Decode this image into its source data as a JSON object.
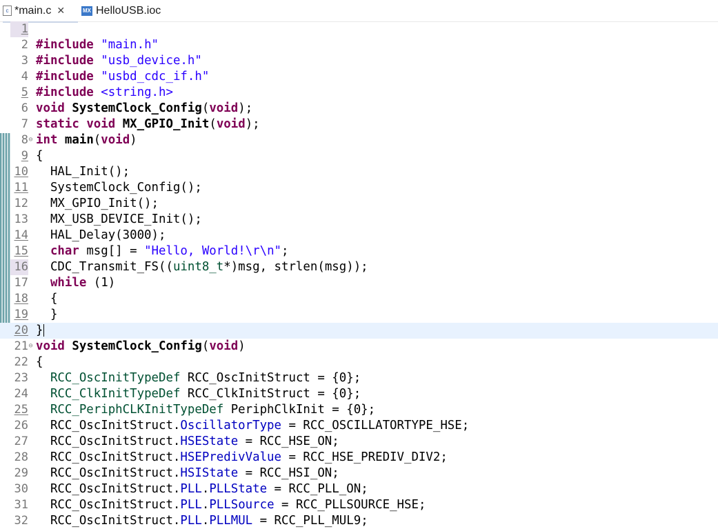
{
  "tabs": [
    {
      "label": "*main.c",
      "icon": "c-file-icon",
      "active": true
    },
    {
      "label": "HelloUSB.ioc",
      "icon": "mx-file-icon",
      "active": false
    }
  ],
  "lines": [
    {
      "n": "1",
      "u": true,
      "hl": true,
      "tokens": []
    },
    {
      "n": "2",
      "tokens": [
        {
          "c": "kw",
          "t": "#include"
        },
        {
          "t": " "
        },
        {
          "c": "str",
          "t": "\"main.h\""
        }
      ]
    },
    {
      "n": "3",
      "tokens": [
        {
          "c": "kw",
          "t": "#include"
        },
        {
          "t": " "
        },
        {
          "c": "str",
          "t": "\"usb_device.h\""
        }
      ]
    },
    {
      "n": "4",
      "tokens": [
        {
          "c": "kw",
          "t": "#include"
        },
        {
          "t": " "
        },
        {
          "c": "str",
          "t": "\"usbd_cdc_if.h\""
        }
      ]
    },
    {
      "n": "5",
      "u": true,
      "tokens": [
        {
          "c": "kw",
          "t": "#include"
        },
        {
          "t": " "
        },
        {
          "c": "str",
          "t": "<string.h>"
        }
      ]
    },
    {
      "n": "6",
      "tokens": [
        {
          "c": "kw",
          "t": "void"
        },
        {
          "t": " "
        },
        {
          "c": "b",
          "t": "SystemClock_Config"
        },
        {
          "t": "("
        },
        {
          "c": "kw",
          "t": "void"
        },
        {
          "t": ");"
        }
      ]
    },
    {
      "n": "7",
      "tokens": [
        {
          "c": "kw",
          "t": "static"
        },
        {
          "t": " "
        },
        {
          "c": "kw",
          "t": "void"
        },
        {
          "t": " "
        },
        {
          "c": "b",
          "t": "MX_GPIO_Init"
        },
        {
          "t": "("
        },
        {
          "c": "kw",
          "t": "void"
        },
        {
          "t": ");"
        }
      ]
    },
    {
      "n": "8",
      "fold": true,
      "tokens": [
        {
          "c": "kw",
          "t": "int"
        },
        {
          "t": " "
        },
        {
          "c": "b",
          "t": "main"
        },
        {
          "t": "("
        },
        {
          "c": "kw",
          "t": "void"
        },
        {
          "t": ")"
        }
      ]
    },
    {
      "n": "9",
      "u": true,
      "tokens": [
        {
          "t": "{"
        }
      ]
    },
    {
      "n": "10",
      "u": true,
      "tokens": [
        {
          "t": "  HAL_Init();"
        }
      ]
    },
    {
      "n": "11",
      "u": true,
      "tokens": [
        {
          "t": "  SystemClock_Config();"
        }
      ]
    },
    {
      "n": "12",
      "tokens": [
        {
          "t": "  MX_GPIO_Init();"
        }
      ]
    },
    {
      "n": "13",
      "tokens": [
        {
          "t": "  MX_USB_DEVICE_Init();"
        }
      ]
    },
    {
      "n": "14",
      "u": true,
      "tokens": [
        {
          "t": "  HAL_Delay(3000);"
        }
      ]
    },
    {
      "n": "15",
      "u": true,
      "tokens": [
        {
          "t": "  "
        },
        {
          "c": "kw",
          "t": "char"
        },
        {
          "t": " msg[] = "
        },
        {
          "c": "str",
          "t": "\"Hello, World!\\r\\n\""
        },
        {
          "t": ";"
        }
      ]
    },
    {
      "n": "16",
      "hl": true,
      "tokens": [
        {
          "t": "  CDC_Transmit_FS(("
        },
        {
          "c": "typ",
          "t": "uint8_t"
        },
        {
          "t": "*)msg, strlen(msg));"
        }
      ]
    },
    {
      "n": "17",
      "tokens": [
        {
          "t": "  "
        },
        {
          "c": "kw",
          "t": "while"
        },
        {
          "t": " (1)"
        }
      ]
    },
    {
      "n": "18",
      "u": true,
      "tokens": [
        {
          "t": "  {"
        }
      ]
    },
    {
      "n": "19",
      "u": true,
      "tokens": [
        {
          "t": "  }"
        }
      ]
    },
    {
      "n": "20",
      "u": true,
      "current": true,
      "caret": true,
      "tokens": [
        {
          "t": "}"
        }
      ]
    },
    {
      "n": "21",
      "fold": true,
      "tokens": [
        {
          "c": "kw",
          "t": "void"
        },
        {
          "t": " "
        },
        {
          "c": "b",
          "t": "SystemClock_Config"
        },
        {
          "t": "("
        },
        {
          "c": "kw",
          "t": "void"
        },
        {
          "t": ")"
        }
      ]
    },
    {
      "n": "22",
      "tokens": [
        {
          "t": "{"
        }
      ]
    },
    {
      "n": "23",
      "tokens": [
        {
          "t": "  "
        },
        {
          "c": "typ",
          "t": "RCC_OscInitTypeDef"
        },
        {
          "t": " RCC_OscInitStruct = {0};"
        }
      ]
    },
    {
      "n": "24",
      "tokens": [
        {
          "t": "  "
        },
        {
          "c": "typ",
          "t": "RCC_ClkInitTypeDef"
        },
        {
          "t": " RCC_ClkInitStruct = {0};"
        }
      ]
    },
    {
      "n": "25",
      "u": true,
      "tokens": [
        {
          "t": "  "
        },
        {
          "c": "typ",
          "t": "RCC_PeriphCLKInitTypeDef"
        },
        {
          "t": " PeriphClkInit = {0};"
        }
      ]
    },
    {
      "n": "26",
      "tokens": [
        {
          "t": "  RCC_OscInitStruct."
        },
        {
          "c": "fld",
          "t": "OscillatorType"
        },
        {
          "t": " = RCC_OSCILLATORTYPE_HSE;"
        }
      ]
    },
    {
      "n": "27",
      "tokens": [
        {
          "t": "  RCC_OscInitStruct."
        },
        {
          "c": "fld",
          "t": "HSEState"
        },
        {
          "t": " = RCC_HSE_ON;"
        }
      ]
    },
    {
      "n": "28",
      "tokens": [
        {
          "t": "  RCC_OscInitStruct."
        },
        {
          "c": "fld",
          "t": "HSEPredivValue"
        },
        {
          "t": " = RCC_HSE_PREDIV_DIV2;"
        }
      ]
    },
    {
      "n": "29",
      "tokens": [
        {
          "t": "  RCC_OscInitStruct."
        },
        {
          "c": "fld",
          "t": "HSIState"
        },
        {
          "t": " = RCC_HSI_ON;"
        }
      ]
    },
    {
      "n": "30",
      "tokens": [
        {
          "t": "  RCC_OscInitStruct."
        },
        {
          "c": "fld",
          "t": "PLL"
        },
        {
          "t": "."
        },
        {
          "c": "fld",
          "t": "PLLState"
        },
        {
          "t": " = RCC_PLL_ON;"
        }
      ]
    },
    {
      "n": "31",
      "tokens": [
        {
          "t": "  RCC_OscInitStruct."
        },
        {
          "c": "fld",
          "t": "PLL"
        },
        {
          "t": "."
        },
        {
          "c": "fld",
          "t": "PLLSource"
        },
        {
          "t": " = RCC_PLLSOURCE_HSE;"
        }
      ]
    },
    {
      "n": "32",
      "tokens": [
        {
          "t": "  RCC_OscInitStruct."
        },
        {
          "c": "fld",
          "t": "PLL"
        },
        {
          "t": "."
        },
        {
          "c": "fld",
          "t": "PLLMUL"
        },
        {
          "t": " = RCC_PLL_MUL9;"
        }
      ]
    }
  ]
}
